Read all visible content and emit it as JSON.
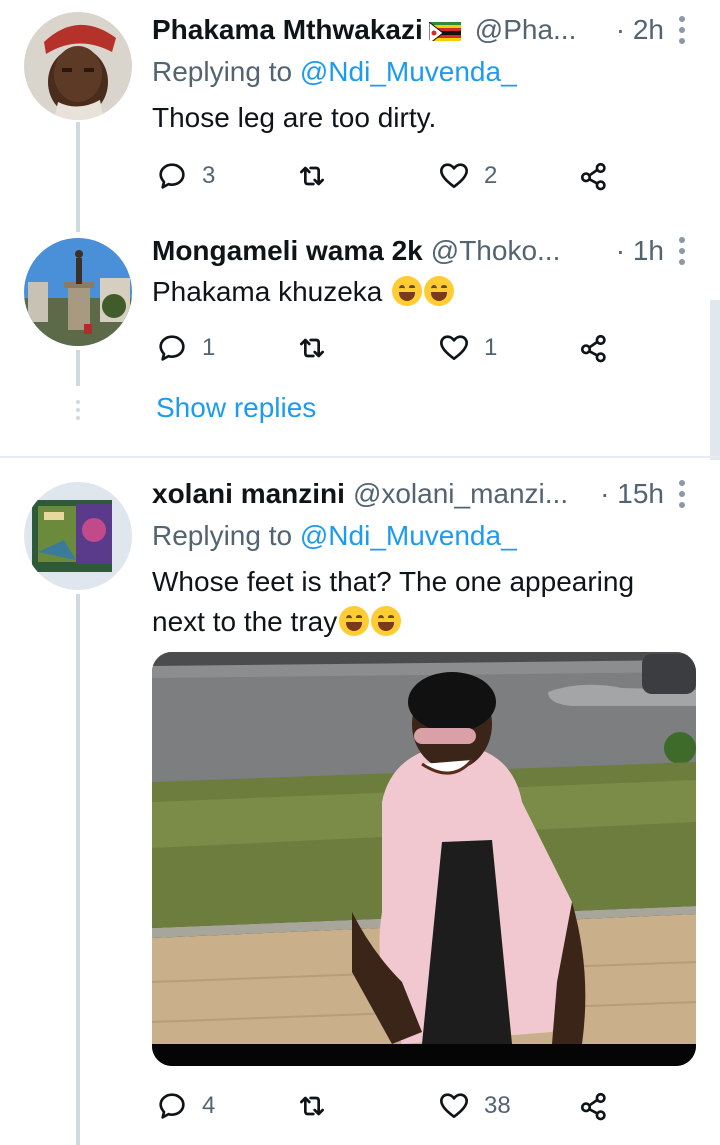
{
  "tweets": [
    {
      "name": "Phakama Mthwakazi",
      "handle": "@Pha...",
      "time": "· 2h",
      "replying_prefix": "Replying to ",
      "replying_handle": "@Ndi_Muvenda_",
      "text": "Those leg are too dirty.",
      "replies": "3",
      "retweets": "",
      "likes": "2"
    },
    {
      "name": "Mongameli wama 2k",
      "handle": "@Thoko...",
      "time": "· 1h",
      "text": "Phakama khuzeka",
      "replies": "1",
      "retweets": "",
      "likes": "1"
    },
    {
      "name": "xolani manzini",
      "handle": "@xolani_manzi...",
      "time": "· 15h",
      "replying_prefix": "Replying to ",
      "replying_handle": "@Ndi_Muvenda_",
      "text_line1": "Whose feet is that? The one appearing",
      "text_line2": "next to the tray",
      "replies": "4",
      "retweets": "",
      "likes": "38"
    }
  ],
  "show_replies": "Show replies",
  "icons": {
    "reply": "reply-icon",
    "retweet": "retweet-icon",
    "like": "heart-icon",
    "share": "share-icon",
    "more": "more-options-icon"
  },
  "colors": {
    "link": "#1d9bf0",
    "secondary": "#536471",
    "thread_line": "#cfd9de"
  }
}
